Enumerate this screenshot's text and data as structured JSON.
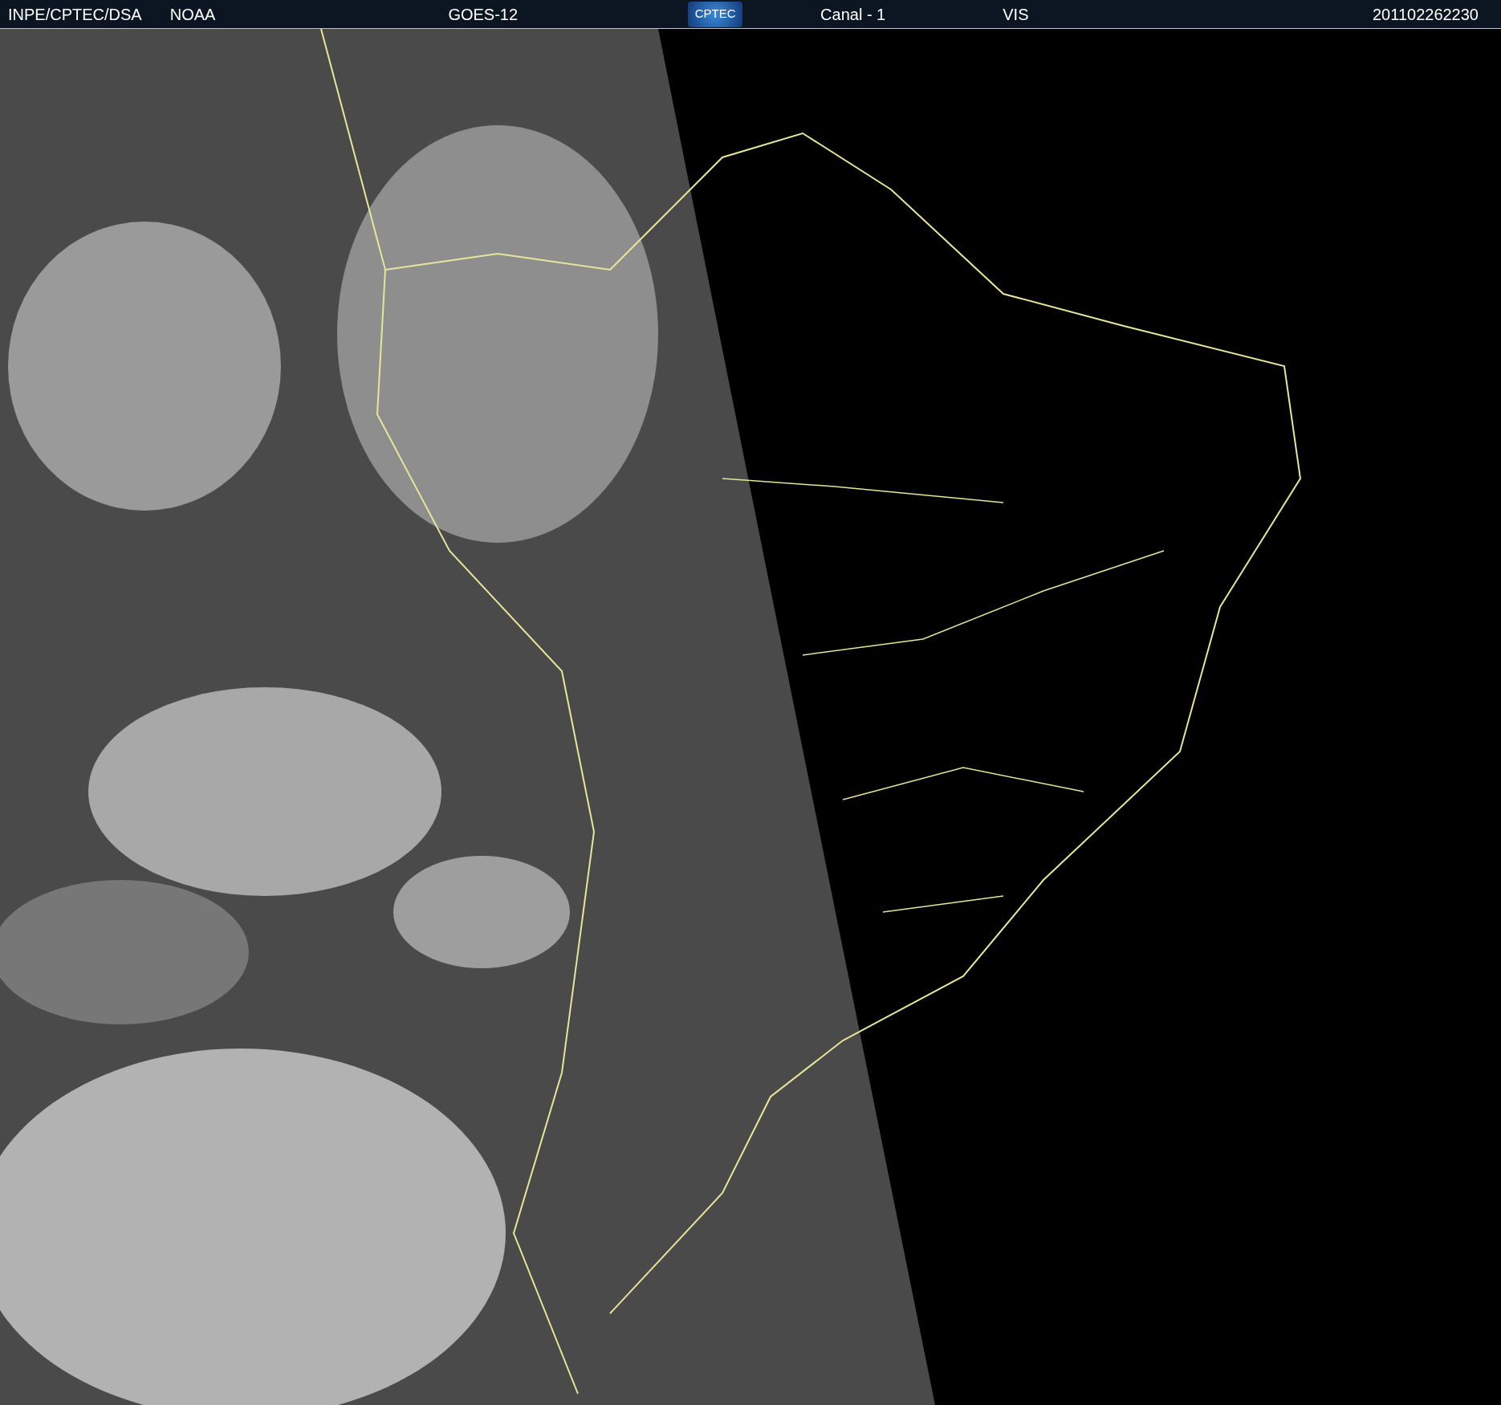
{
  "header": {
    "source": "INPE/CPTEC/DSA",
    "agency": "NOAA",
    "satellite": "GOES-12",
    "logo": "CPTEC",
    "channel": "Canal - 1",
    "band": "VIS",
    "timestamp": "201102262230"
  }
}
